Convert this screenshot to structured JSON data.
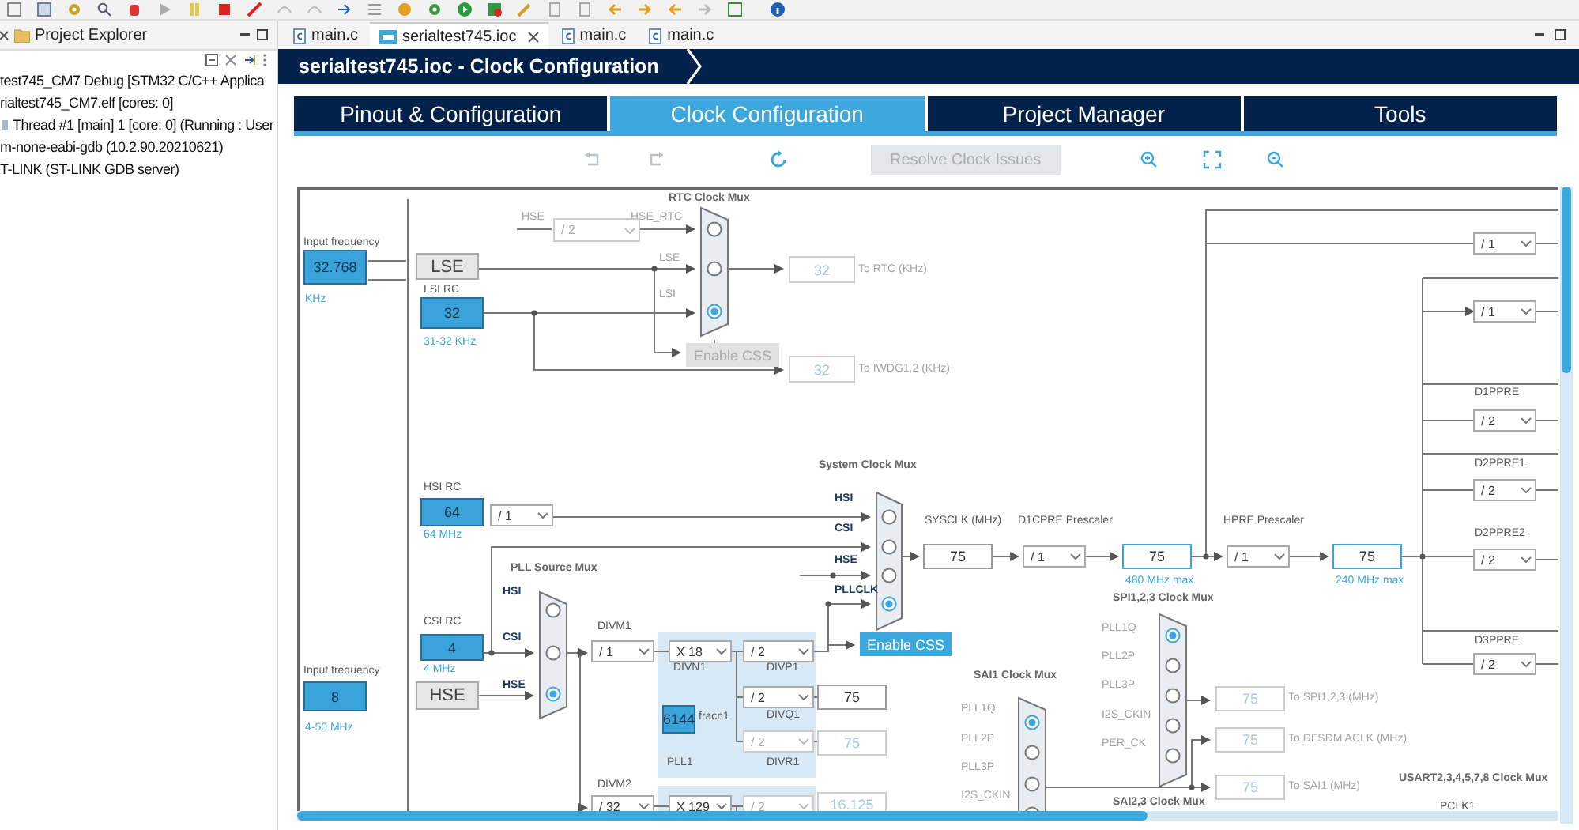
{
  "project_explorer": {
    "title": "Project Explorer",
    "items": [
      {
        "label": "test745_CM7 Debug [STM32 C/C++ Applica",
        "kind": "node"
      },
      {
        "label": "rialtest745_CM7.elf [cores: 0]",
        "kind": "node"
      },
      {
        "label": "Thread #1 [main] 1 [core: 0] (Running : User",
        "kind": "thread"
      },
      {
        "label": "m-none-eabi-gdb (10.2.90.20210621)",
        "kind": "node"
      },
      {
        "label": "T-LINK (ST-LINK GDB server)",
        "kind": "node"
      }
    ]
  },
  "editor_tabs": [
    {
      "label": "main.c",
      "kind": "c",
      "selected": false
    },
    {
      "label": "serialtest745.ioc",
      "kind": "mx",
      "selected": true
    },
    {
      "label": "main.c",
      "kind": "c",
      "selected": false
    },
    {
      "label": "main.c",
      "kind": "c",
      "selected": false
    }
  ],
  "header": {
    "title": "serialtest745.ioc - Clock Configuration"
  },
  "tabs": [
    {
      "label": "Pinout & Configuration",
      "selected": false
    },
    {
      "label": "Clock Configuration",
      "selected": true
    },
    {
      "label": "Project Manager",
      "selected": false
    },
    {
      "label": "Tools",
      "selected": false
    }
  ],
  "toolbar": {
    "resolve_button": {
      "label": "Resolve Clock Issues",
      "disabled": true
    }
  },
  "diagram": {
    "labels": [
      {
        "text": "Input frequency",
        "kind": "plain"
      },
      {
        "text": "KHz",
        "kind": "hint"
      },
      {
        "text": "LSI RC",
        "kind": "plain"
      },
      {
        "text": "31-32 KHz",
        "kind": "hint"
      },
      {
        "text": "RTC Clock Mux",
        "kind": "title"
      },
      {
        "text": "HSE",
        "kind": "muted"
      },
      {
        "text": "HSE_RTC",
        "kind": "muted"
      },
      {
        "text": "LSE",
        "kind": "muted"
      },
      {
        "text": "LSI",
        "kind": "muted"
      },
      {
        "text": "To RTC (KHz)",
        "kind": "muted"
      },
      {
        "text": "To IWDG1,2 (KHz)",
        "kind": "muted"
      },
      {
        "text": "HSI RC",
        "kind": "plain"
      },
      {
        "text": "64 MHz",
        "kind": "hint"
      },
      {
        "text": "System Clock Mux",
        "kind": "title"
      },
      {
        "text": "HSI",
        "kind": "signal"
      },
      {
        "text": "CSI",
        "kind": "signal"
      },
      {
        "text": "HSE",
        "kind": "signal"
      },
      {
        "text": "PLLCLK",
        "kind": "signal"
      },
      {
        "text": "SYSCLK (MHz)",
        "kind": "plain"
      },
      {
        "text": "D1CPRE Prescaler",
        "kind": "plain"
      },
      {
        "text": "HPRE Prescaler",
        "kind": "plain"
      },
      {
        "text": "480 MHz max",
        "kind": "hint"
      },
      {
        "text": "240 MHz max",
        "kind": "hint"
      },
      {
        "text": "PLL Source Mux",
        "kind": "title"
      },
      {
        "text": "HSI",
        "kind": "signal"
      },
      {
        "text": "CSI",
        "kind": "signal"
      },
      {
        "text": "CSI RC",
        "kind": "plain"
      },
      {
        "text": "4 MHz",
        "kind": "hint"
      },
      {
        "text": "HSE",
        "kind": "signal"
      },
      {
        "text": "Input frequency",
        "kind": "plain"
      },
      {
        "text": "4-50 MHz",
        "kind": "hint"
      },
      {
        "text": "DIVM1",
        "kind": "plain"
      },
      {
        "text": "DIVN1",
        "kind": "plain"
      },
      {
        "text": "DIVP1",
        "kind": "plain"
      },
      {
        "text": "fracn1",
        "kind": "plain"
      },
      {
        "text": "DIVQ1",
        "kind": "plain"
      },
      {
        "text": "PLL1",
        "kind": "plain"
      },
      {
        "text": "DIVR1",
        "kind": "plain"
      },
      {
        "text": "DIVM2",
        "kind": "plain"
      },
      {
        "text": "SPI1,2,3 Clock Mux",
        "kind": "title"
      },
      {
        "text": "PLL1Q",
        "kind": "muted"
      },
      {
        "text": "PLL2P",
        "kind": "muted"
      },
      {
        "text": "PLL3P",
        "kind": "muted"
      },
      {
        "text": "I2S_CKIN",
        "kind": "muted"
      },
      {
        "text": "PER_CK",
        "kind": "muted"
      },
      {
        "text": "SAI1 Clock Mux",
        "kind": "title"
      },
      {
        "text": "PLL1Q",
        "kind": "muted"
      },
      {
        "text": "PLL2P",
        "kind": "muted"
      },
      {
        "text": "PLL3P",
        "kind": "muted"
      },
      {
        "text": "I2S_CKIN",
        "kind": "muted"
      },
      {
        "text": "SAI2,3 Clock Mux",
        "kind": "title"
      },
      {
        "text": "To SPI1,2,3 (MHz)",
        "kind": "muted"
      },
      {
        "text": "To DFSDM ACLK (MHz)",
        "kind": "muted"
      },
      {
        "text": "To SAI1 (MHz)",
        "kind": "muted"
      },
      {
        "text": "D1PPRE",
        "kind": "plain"
      },
      {
        "text": "D2PPRE1",
        "kind": "plain"
      },
      {
        "text": "D2PPRE2",
        "kind": "plain"
      },
      {
        "text": "D3PPRE",
        "kind": "plain"
      },
      {
        "text": "USART2,3,4,5,7,8 Clock Mux",
        "kind": "title"
      },
      {
        "text": "PCLK1",
        "kind": "plain"
      }
    ],
    "fields": [
      {
        "value": "32.768",
        "kind": "input"
      },
      {
        "value": "32",
        "kind": "input"
      },
      {
        "value": "32",
        "kind": "disabled"
      },
      {
        "value": "32",
        "kind": "disabled"
      },
      {
        "value": "64",
        "kind": "input"
      },
      {
        "value": "75",
        "kind": "output"
      },
      {
        "value": "75",
        "kind": "result"
      },
      {
        "value": "75",
        "kind": "result"
      },
      {
        "value": "4",
        "kind": "input"
      },
      {
        "value": "8",
        "kind": "input"
      },
      {
        "value": "6144",
        "kind": "input"
      },
      {
        "value": "75",
        "kind": "output"
      },
      {
        "value": "75",
        "kind": "disabled"
      },
      {
        "value": "16.125",
        "kind": "disabled"
      },
      {
        "value": "75",
        "kind": "disabled"
      },
      {
        "value": "75",
        "kind": "disabled"
      },
      {
        "value": "75",
        "kind": "disabled"
      }
    ],
    "blocks": [
      {
        "label": "LSE"
      },
      {
        "label": "HSE"
      }
    ],
    "dropdowns": [
      {
        "value": "/ 2",
        "disabled": true
      },
      {
        "value": "/ 1",
        "disabled": false
      },
      {
        "value": "/ 1",
        "disabled": false
      },
      {
        "value": "X 18",
        "disabled": false
      },
      {
        "value": "/ 2",
        "disabled": false
      },
      {
        "value": "/ 2",
        "disabled": false
      },
      {
        "value": "/ 2",
        "disabled": true
      },
      {
        "value": "/ 32",
        "disabled": false
      },
      {
        "value": "X 129",
        "disabled": false
      },
      {
        "value": "/ 2",
        "disabled": true
      },
      {
        "value": "/ 1",
        "disabled": false
      },
      {
        "value": "/ 1",
        "disabled": false
      },
      {
        "value": "/ 1",
        "disabled": false
      },
      {
        "value": "/ 1",
        "disabled": false
      },
      {
        "value": "/ 2",
        "disabled": false
      },
      {
        "value": "/ 2",
        "disabled": false
      },
      {
        "value": "/ 2",
        "disabled": false
      },
      {
        "value": "/ 2",
        "disabled": false
      }
    ],
    "buttons": [
      {
        "label": "Enable CSS",
        "disabled": true
      },
      {
        "label": "Enable CSS",
        "disabled": false
      }
    ],
    "muxes": [
      {
        "options": [
          {
            "selected": false
          },
          {
            "selected": false
          },
          {
            "selected": true
          }
        ]
      },
      {
        "options": [
          {
            "selected": false
          },
          {
            "selected": false
          },
          {
            "selected": false
          },
          {
            "selected": true
          }
        ]
      },
      {
        "options": [
          {
            "selected": false
          },
          {
            "selected": false
          },
          {
            "selected": true
          }
        ]
      },
      {
        "options": [
          {
            "selected": true
          },
          {
            "selected": false
          },
          {
            "selected": false
          },
          {
            "selected": false
          },
          {
            "selected": false
          }
        ]
      },
      {
        "options": [
          {
            "selected": true
          },
          {
            "selected": false
          },
          {
            "selected": false
          },
          {
            "selected": false
          }
        ]
      }
    ]
  }
}
